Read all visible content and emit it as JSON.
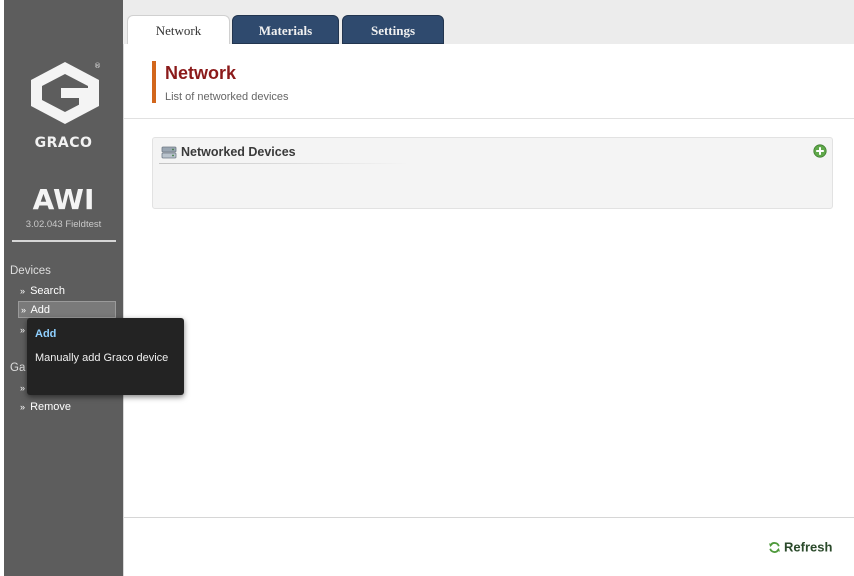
{
  "brand": {
    "logo_icon": "graco-g-logo-icon",
    "name": "GRACO",
    "registered_mark": "®"
  },
  "product": {
    "name": "AWI",
    "version": "3.02.043 Fieldtest"
  },
  "sidebar": {
    "sections": [
      {
        "heading": "Devices",
        "items": [
          {
            "label": "Search"
          },
          {
            "label": "Add",
            "selected": true
          },
          {
            "label": ""
          }
        ]
      },
      {
        "heading": "Ga",
        "items": [
          {
            "label": ""
          },
          {
            "label": "Remove"
          }
        ]
      }
    ]
  },
  "tooltip": {
    "title": "Add",
    "description": "Manually add Graco device"
  },
  "tabs": [
    {
      "label": "Network",
      "active": true
    },
    {
      "label": "Materials",
      "active": false
    },
    {
      "label": "Settings",
      "active": false
    }
  ],
  "page": {
    "title": "Network",
    "subtitle": "List of networked devices"
  },
  "panel": {
    "title": "Networked Devices",
    "icon": "network-device-icon",
    "add_icon": "add-circle-icon"
  },
  "footer": {
    "refresh_label": "Refresh",
    "refresh_icon": "refresh-icon"
  },
  "colors": {
    "sidebar_bg": "#5d5d5d",
    "tab_inactive_bg": "#2f4a6e",
    "title_color": "#8b1a1a",
    "title_accent": "#d2661c",
    "tooltip_title": "#8fd0ff"
  }
}
